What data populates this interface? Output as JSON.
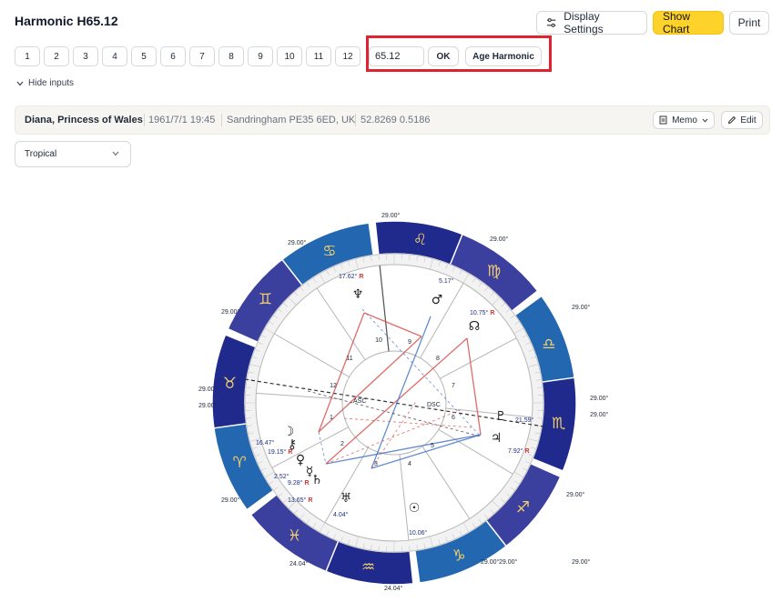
{
  "title": "Harmonic H65.12",
  "top_actions": {
    "display_settings": "Display Settings",
    "show_chart": "Show Chart",
    "print": "Print"
  },
  "harmonics": [
    "1",
    "2",
    "3",
    "4",
    "5",
    "6",
    "7",
    "8",
    "9",
    "10",
    "11",
    "12"
  ],
  "harmonic_input": {
    "value": "65.12"
  },
  "ok_label": "OK",
  "age_harmonic_label": "Age Harmonic",
  "hide_inputs_label": "Hide inputs",
  "person": {
    "name": "Diana, Princess of Wales",
    "datetime": "1961/7/1 19:45",
    "place": "Sandringham PE35 6ED, UK",
    "coords": "52.8269 0.5186",
    "memo_label": "Memo",
    "edit_label": "Edit"
  },
  "zodiac_select": {
    "value": "Tropical"
  },
  "chart": {
    "cusp_degrees": [
      "29.00°",
      "29.00°",
      "29.00°",
      "29.00°",
      "29.00°",
      "29.00°",
      "29.00°",
      "29.00°",
      "29.00°",
      "29.00°",
      "29.00°",
      "29.00°",
      "24.04°",
      "24.04°",
      "29.00°",
      "29.00°"
    ],
    "sign_glyphs": [
      "♌",
      "♍",
      "♎",
      "♏",
      "♐",
      "♑",
      "♒",
      "♓",
      "♈",
      "♉",
      "♊",
      "♋"
    ],
    "house_numbers": [
      "1",
      "2",
      "3",
      "4",
      "5",
      "6",
      "7",
      "8",
      "9",
      "10",
      "11",
      "12"
    ],
    "asc_label": "ASC",
    "dsc_label": "DSC",
    "retrograde_mark": "R",
    "planets": [
      {
        "name": "neptune",
        "glyph": "♆",
        "degree": "17.62°",
        "retro": true
      },
      {
        "name": "mars",
        "glyph": "♂",
        "degree": "5.17°",
        "retro": false
      },
      {
        "name": "node",
        "glyph": "☊",
        "degree": "10.75°",
        "retro": true
      },
      {
        "name": "pluto",
        "glyph": "♇",
        "degree": "21.59°",
        "retro": false
      },
      {
        "name": "jupiter",
        "glyph": "♃",
        "degree": "7.92°",
        "retro": true
      },
      {
        "name": "sun",
        "glyph": "☉",
        "degree": "10.06°",
        "retro": false
      },
      {
        "name": "uranus",
        "glyph": "♅",
        "degree": "4.04°",
        "retro": false
      },
      {
        "name": "moon",
        "glyph": "☽",
        "degree": "16.47°",
        "retro": false
      },
      {
        "name": "chiron",
        "glyph": "⚷",
        "degree": "19.15°",
        "retro": true
      },
      {
        "name": "venus",
        "glyph": "♀",
        "degree": "2.52°",
        "retro": false
      },
      {
        "name": "mercury",
        "glyph": "☿",
        "degree": "9.28°",
        "retro": true
      },
      {
        "name": "saturn",
        "glyph": "♄",
        "degree": "13.65°",
        "retro": true
      }
    ],
    "colors": {
      "ring_dark": "#1f2a8c",
      "ring_mid": "#3b3f9e",
      "ring_blue": "#2367b0",
      "aspect_red": "#d9534f",
      "aspect_blue": "#4a78c8",
      "degree_text": "#1e2f86"
    }
  }
}
